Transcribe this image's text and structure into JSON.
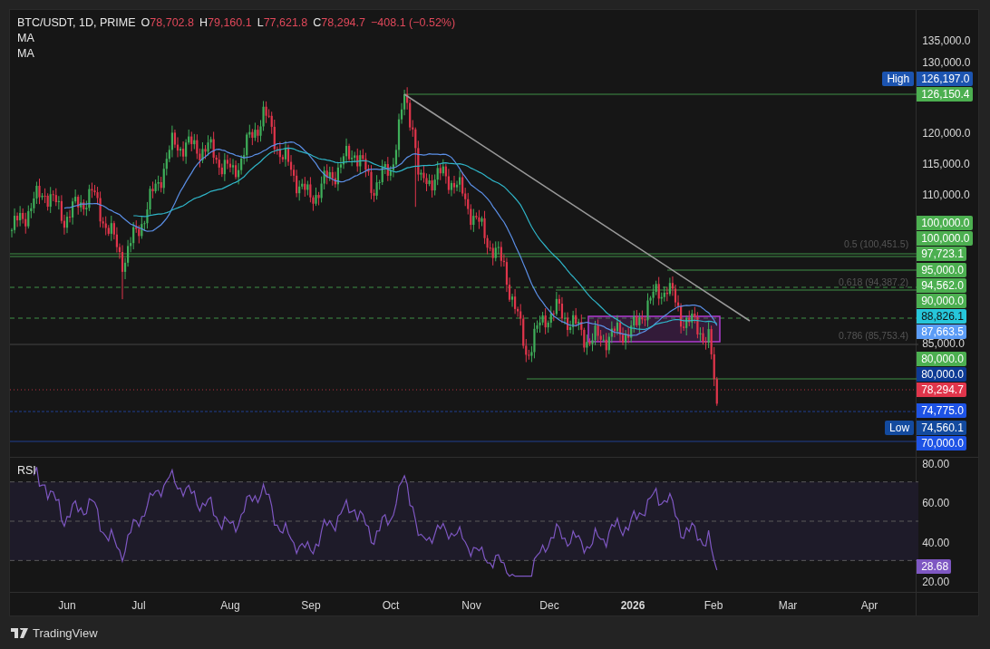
{
  "legend": {
    "symbol": "BTC/USDT, 1D, PRIME",
    "color": "#e0485a",
    "ohlc": [
      {
        "label": "O",
        "value": "78,702.8"
      },
      {
        "label": "H",
        "value": "79,160.1"
      },
      {
        "label": "L",
        "value": "77,621.8"
      },
      {
        "label": "C",
        "value": "78,294.7"
      }
    ],
    "change": "−408.1 (−0.52%)",
    "indicators": [
      "MA",
      "MA"
    ]
  },
  "fib_labels": [
    "0.5 (100,451.5)",
    "0.618 (94,387.2)",
    "0.786 (85,753.4)"
  ],
  "price_axis": [
    "135,000.0",
    "130,000.0",
    "120,000.0",
    "115,000.0",
    "110,000.0",
    "85,000.0"
  ],
  "price_tags": [
    {
      "text": "126,197.0",
      "color": "#1c54b0",
      "side_label": "High"
    },
    {
      "text": "126,150.4",
      "color": "#4caf50"
    },
    {
      "text": "100,000.0",
      "color": "#4caf50"
    },
    {
      "text": "100,000.0",
      "color": "#4caf50"
    },
    {
      "text": "97,723.1",
      "color": "#4caf50"
    },
    {
      "text": "95,000.0",
      "color": "#4caf50"
    },
    {
      "text": "94,562.0",
      "color": "#4caf50"
    },
    {
      "text": "90,000.0",
      "color": "#4caf50"
    },
    {
      "text": "88,826.1",
      "color": "#26c6da"
    },
    {
      "text": "87,663.5",
      "color": "#5b9cf6"
    },
    {
      "text": "80,000.0",
      "color": "#4caf50"
    },
    {
      "text": "80,000.0",
      "color": "#0d3a94"
    },
    {
      "text": "78,294.7",
      "color": "#e0354b"
    },
    {
      "text": "74,775.0",
      "color": "#1e53e5"
    },
    {
      "text": "74,560.1",
      "color": "#134a9e",
      "side_label": "Low"
    },
    {
      "text": "70,000.0",
      "color": "#1e53e5"
    }
  ],
  "rsi": {
    "label": "RSI",
    "axis": [
      "80.00",
      "60.00",
      "40.00",
      "20.00"
    ],
    "tag": "28.68"
  },
  "time_axis": [
    {
      "text": "Jun",
      "kind": "month"
    },
    {
      "text": "Jul",
      "kind": "month"
    },
    {
      "text": "Aug",
      "kind": "month"
    },
    {
      "text": "Sep",
      "kind": "month"
    },
    {
      "text": "Oct",
      "kind": "month"
    },
    {
      "text": "Nov",
      "kind": "month"
    },
    {
      "text": "Dec",
      "kind": "month"
    },
    {
      "text": "2026",
      "kind": "year"
    },
    {
      "text": "Feb",
      "kind": "month"
    },
    {
      "text": "Mar",
      "kind": "month"
    },
    {
      "text": "Apr",
      "kind": "month"
    }
  ],
  "footer": {
    "brand": "TradingView"
  }
}
